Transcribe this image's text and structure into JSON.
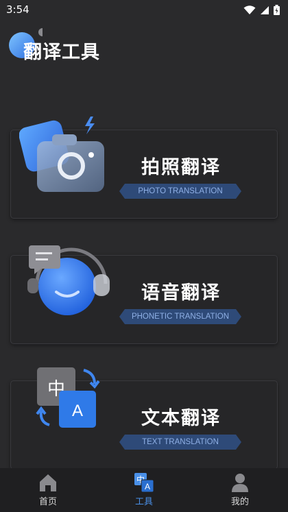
{
  "status_bar": {
    "time": "3:54"
  },
  "header": {
    "title": "翻译工具"
  },
  "cards": [
    {
      "title": "拍照翻译",
      "subtitle": "PHOTO TRANSLATION",
      "icon": "camera-icon"
    },
    {
      "title": "语音翻译",
      "subtitle": "PHONETIC TRANSLATION",
      "icon": "headphone-chat-icon"
    },
    {
      "title": "文本翻译",
      "subtitle": "TEXT TRANSLATION",
      "icon": "translate-text-icon",
      "glyph_zh": "中",
      "glyph_a": "A"
    }
  ],
  "bottom_nav": {
    "items": [
      {
        "label": "首页",
        "icon": "home-icon",
        "active": false
      },
      {
        "label": "工具",
        "icon": "translate-tool-icon",
        "active": true,
        "glyph_zh": "中",
        "glyph_a": "A"
      },
      {
        "label": "我的",
        "icon": "user-icon",
        "active": false
      }
    ]
  },
  "colors": {
    "accent": "#4a90e8",
    "badge_bg": "#2e4a78",
    "background": "#2a2a2c"
  }
}
